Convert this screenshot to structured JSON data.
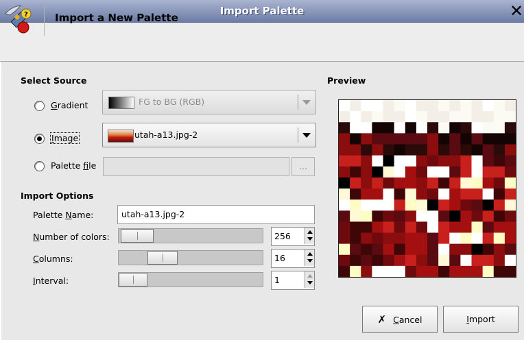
{
  "window": {
    "title": "Import Palette"
  },
  "header": {
    "title": "Import a New Palette"
  },
  "select_source": {
    "heading": "Select Source",
    "gradient": {
      "label_pre": "",
      "label_u": "G",
      "label_post": "radient",
      "selected": false,
      "combo_value": "FG to BG (RGB)",
      "enabled": false
    },
    "image": {
      "label_pre": "",
      "label_u": "I",
      "label_post": "mage",
      "selected": true,
      "combo_value": "utah-a13.jpg-2",
      "enabled": true
    },
    "palette_file": {
      "label_pre": "Palette ",
      "label_u": "f",
      "label_post": "ile",
      "selected": false,
      "value": "",
      "browse_label": "...",
      "enabled": false
    }
  },
  "import_options": {
    "heading": "Import Options",
    "palette_name": {
      "label_pre": "Palette ",
      "label_u": "N",
      "label_post": "ame:",
      "value": "utah-a13.jpg-2"
    },
    "number_of_colors": {
      "label_pre": "",
      "label_u": "N",
      "label_post": "umber of colors:",
      "value": "256",
      "fraction": 0.02
    },
    "columns": {
      "label_pre": "",
      "label_u": "C",
      "label_post": "olumns:",
      "value": "16",
      "fraction": 0.25
    },
    "interval": {
      "label_pre": "",
      "label_u": "I",
      "label_post": "nterval:",
      "value": "1",
      "fraction": 0.0
    }
  },
  "preview": {
    "heading": "Preview"
  },
  "buttons": {
    "cancel": {
      "label_pre": "",
      "label_u": "C",
      "label_post": "ancel"
    },
    "import": {
      "label_pre": "",
      "label_u": "I",
      "label_post": "mport"
    }
  },
  "colors": {
    "titlebar_start": "#aab4d2",
    "titlebar_end": "#6c7ca4",
    "preview_palette": [
      "#ffffff",
      "#fbfbf3",
      "#f3efe6",
      "#2b0a0a",
      "#140404",
      "#5a0b12",
      "#8b0d0d",
      "#6e0a0e",
      "#3e0606",
      "#a40f10",
      "#c8211d",
      "#fdfcc5",
      "#fff9d8",
      "#000000",
      "#7a1f15",
      "#e4d3a8"
    ]
  }
}
